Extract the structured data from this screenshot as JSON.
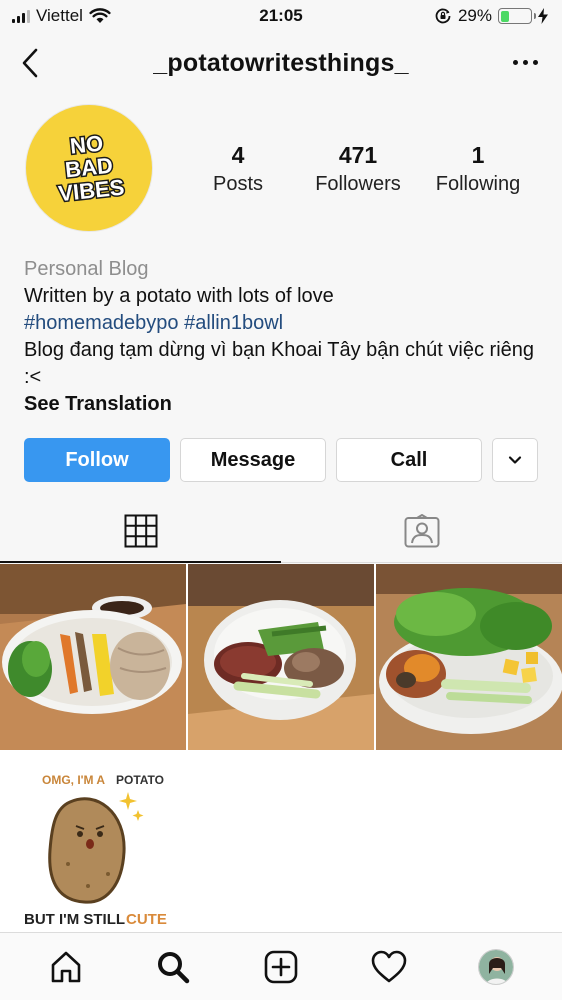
{
  "status_bar": {
    "carrier": "Viettel",
    "time": "21:05",
    "battery_percent": "29%",
    "battery_level": 0.29,
    "icons": [
      "signal-icon",
      "wifi-icon",
      "orientation-lock-icon",
      "battery-icon",
      "charging-icon"
    ]
  },
  "header": {
    "username": "_potatowritesthings_",
    "icons": [
      "back-chevron-icon",
      "more-options-icon"
    ]
  },
  "profile": {
    "avatar_text": [
      "NO",
      "BAD",
      "VIBES"
    ],
    "stats": [
      {
        "value": "4",
        "label": "Posts"
      },
      {
        "value": "471",
        "label": "Followers"
      },
      {
        "value": "1",
        "label": "Following"
      }
    ]
  },
  "bio": {
    "category": "Personal Blog",
    "line1": "Written by a potato with lots of love",
    "hashtags": [
      "#homemadebypo",
      "#allin1bowl"
    ],
    "line2": "Blog đang tạm dừng vì bạn Khoai Tây bận chút việc riêng :<",
    "see_translation": "See Translation"
  },
  "actions": {
    "follow": "Follow",
    "message": "Message",
    "call": "Call"
  },
  "tabs": [
    {
      "name": "grid",
      "icon": "grid-icon",
      "active": true
    },
    {
      "name": "tagged",
      "icon": "tagged-icon",
      "active": false
    }
  ],
  "posts": [
    {
      "description": "noodle bowl"
    },
    {
      "description": "rice bowl"
    },
    {
      "description": "salad bowl"
    },
    {
      "caption_top_a": "OMG, I'M A",
      "caption_top_b": "POTATO",
      "caption_bottom_a": "BUT I'M STILL",
      "caption_bottom_b": "CUTE"
    }
  ],
  "bottom_nav": [
    "home-icon",
    "search-icon",
    "new-post-icon",
    "activity-heart-icon",
    "profile-avatar"
  ],
  "colors": {
    "follow_button": "#3897f0",
    "hashtag": "#234c7e",
    "avatar_bg": "#f6d23a",
    "battery": "#4cd964"
  }
}
